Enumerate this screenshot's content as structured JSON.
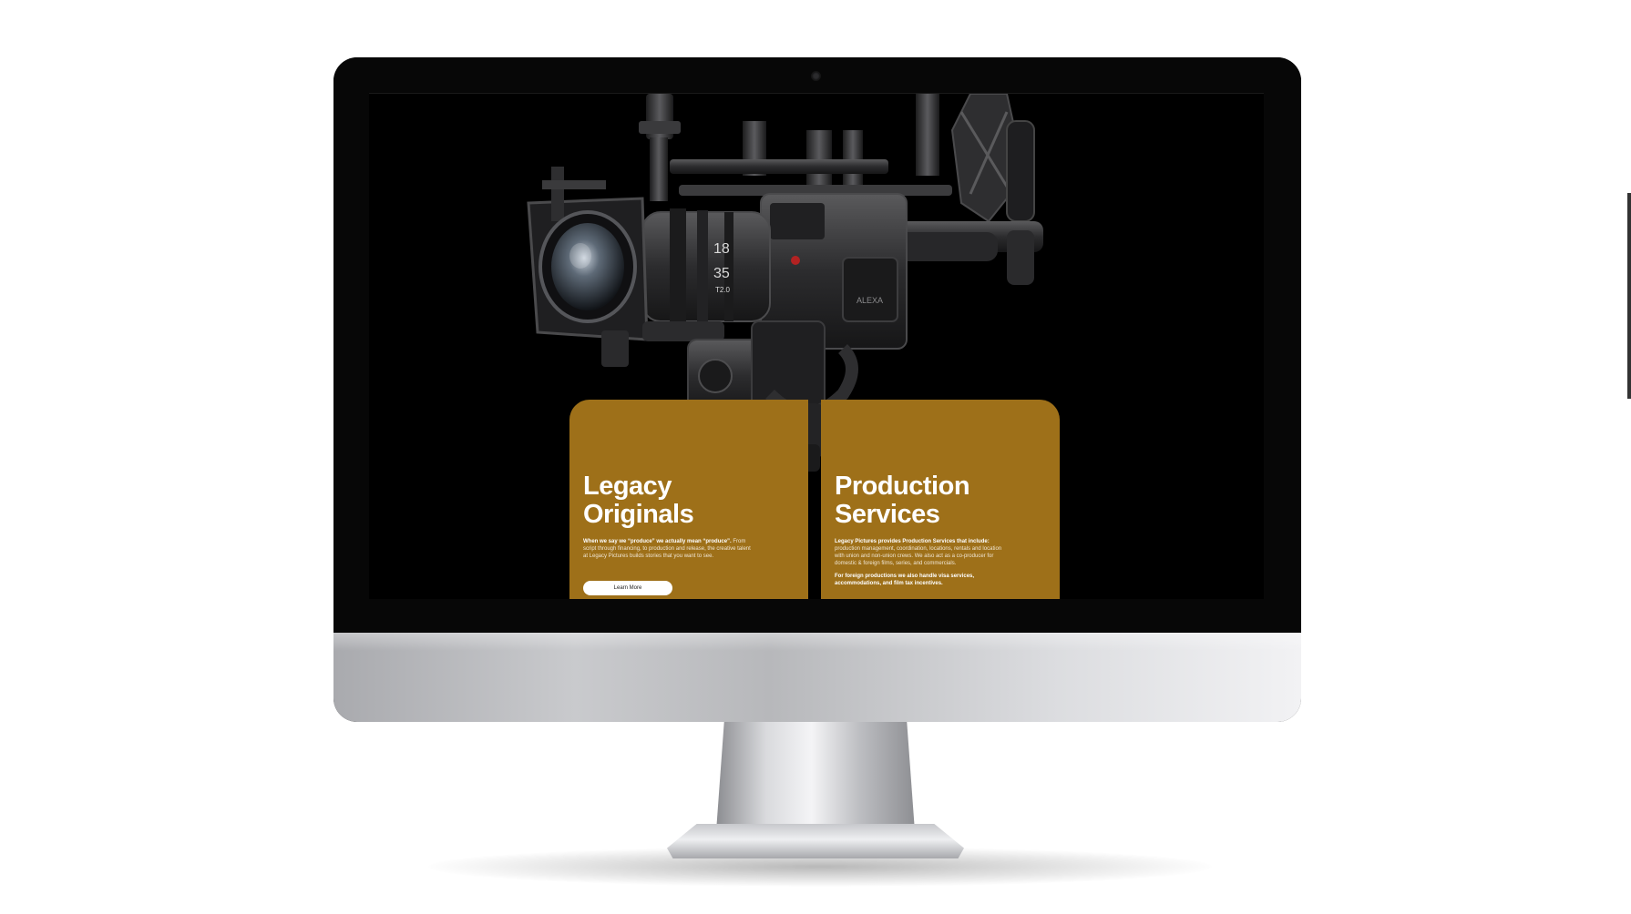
{
  "device": {
    "type": "desktop monitor mockup",
    "bezel_color": "#070707",
    "chin_color": "#c9cacd"
  },
  "hero": {
    "image": "cinema-camera-rig",
    "lens_text": [
      "18",
      "35",
      "T2.0"
    ],
    "brand_mark": "ALEXA"
  },
  "cards": [
    {
      "title_line1": "Legacy",
      "title_line2": "Originals",
      "lead": "When we say we “produce” we actually mean “produce”.",
      "body": "From script through financing, to production and release, the creative talent at Legacy Pictures builds stories that you want to see.",
      "button_label": "Learn More"
    },
    {
      "title_line1": "Production",
      "title_line2": "Services",
      "lead": "Legacy Pictures provides Production Services that include:",
      "body": "production management, coordination, locations, rentals and location with union and non-union crews. We also act as a co-producer for domestic & foreign films, series, and commercials.",
      "note": "For foreign productions we also handle visa services, accommodations, and film tax incentives."
    }
  ],
  "colors": {
    "card_bg": "#9e7019",
    "screen_bg": "#000000",
    "button_bg": "#ffffff"
  }
}
